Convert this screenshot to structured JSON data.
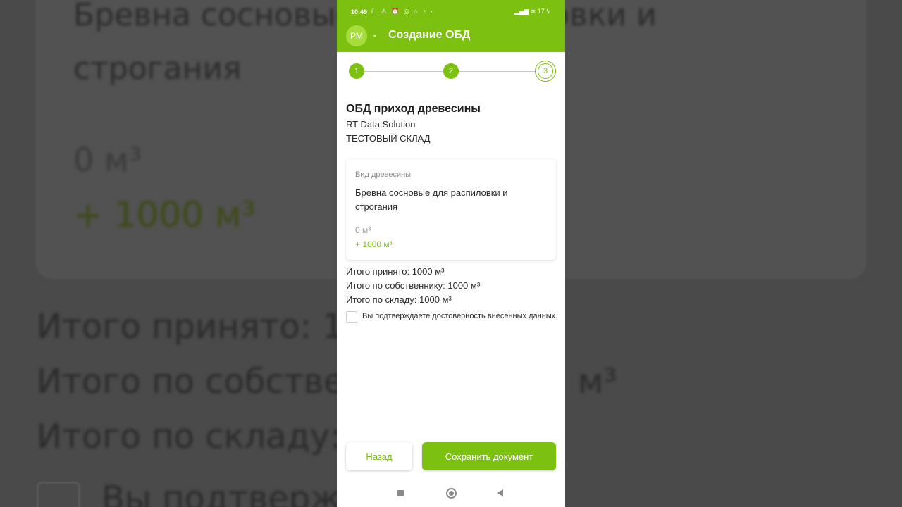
{
  "statusbar": {
    "time": "10:49",
    "icons_left": "☾ ⚠ ⏰ ◎ ⌂ ◔ ·",
    "icons_right": "▂▄▆ ≋ 17 ϟ"
  },
  "appbar": {
    "avatar_initials": "РМ",
    "title": "Создание ОБД"
  },
  "stepper": {
    "steps": [
      "1",
      "2",
      "3"
    ],
    "current": 3
  },
  "document": {
    "title": "ОБД приход древесины",
    "company": "RT Data Solution",
    "warehouse": "ТЕСТОВЫЙ СКЛАД"
  },
  "card": {
    "label": "Вид древесины",
    "value": "Бревна сосновые для распиловки и строгания",
    "current_volume": "0 м³",
    "added_volume": "+ 1000 м³"
  },
  "totals": {
    "accepted": "Итого принято: 1000 м³",
    "by_owner": "Итого по собственнику: 1000 м³",
    "by_warehouse": "Итого по складу: 1000 м³"
  },
  "confirm": {
    "checked": false,
    "text": "Вы подтверждаете достоверность внесенных данных."
  },
  "buttons": {
    "back": "Назад",
    "save": "Сохранить документ"
  },
  "background": {
    "line1": "Бревна сосновые для распиловки и",
    "line2": "строгания",
    "zero": "0 м³",
    "plus": "+ 1000 м³",
    "total1": "Итого принято: 1",
    "total2": "Итого по собстве",
    "total2_right": "м³",
    "total3": "Итого по складу:",
    "confirm": "Вы подтвержд"
  },
  "colors": {
    "accent": "#7cc110",
    "text": "#2a2a2a",
    "muted": "#8a8a8a"
  }
}
